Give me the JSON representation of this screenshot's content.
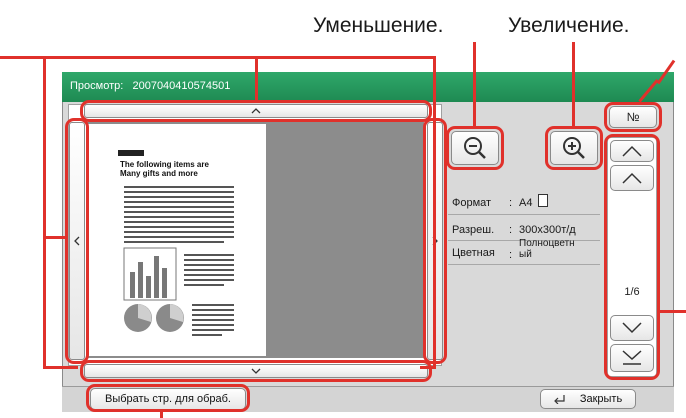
{
  "callouts": {
    "zoom_out": "Уменьшение.",
    "zoom_in": "Увеличение."
  },
  "window": {
    "title_label": "Просмотр:",
    "title_value": "2007040410574501"
  },
  "nav": {
    "up_arrow": "^",
    "down_arrow": "v",
    "left_arrow": "<",
    "right_arrow": ">"
  },
  "page_number_button": "№",
  "document": {
    "heading_line1": "The following items are",
    "heading_line2": "Many gifts and more"
  },
  "info": {
    "rows": [
      {
        "label": "Формат",
        "value": "A4"
      },
      {
        "label": "Разреш.",
        "value": "300x300т/д"
      },
      {
        "label": "Цветная",
        "value": "Полноцветн ый"
      }
    ]
  },
  "pager": {
    "page_indicator": "1/6"
  },
  "footer": {
    "select_page_button": "Выбрать стр. для обраб.",
    "close_button": "Закрыть"
  },
  "colors": {
    "accent_green": "#2fa86a",
    "callout_red": "#e0312b"
  }
}
